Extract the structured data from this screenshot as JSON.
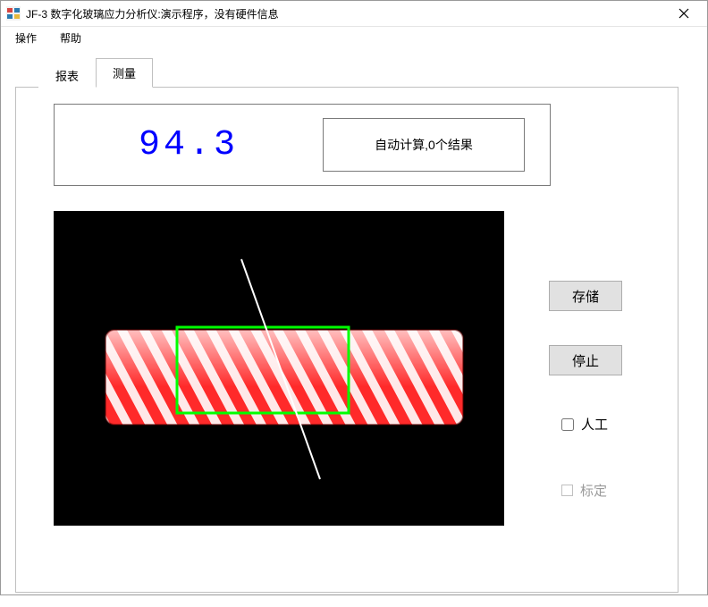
{
  "window": {
    "title": "JF-3 数字化玻璃应力分析仪:演示程序，没有硬件信息"
  },
  "menu": {
    "operate": "操作",
    "help": "帮助"
  },
  "tabs": {
    "report": "报表",
    "measure": "测量"
  },
  "measure": {
    "value": "94.3",
    "status": "自动计算,0个结果",
    "save_button": "存储",
    "stop_button": "停止",
    "manual_label": "人工",
    "calibrate_label": "标定",
    "manual_checked": false,
    "calibrate_enabled": false
  }
}
